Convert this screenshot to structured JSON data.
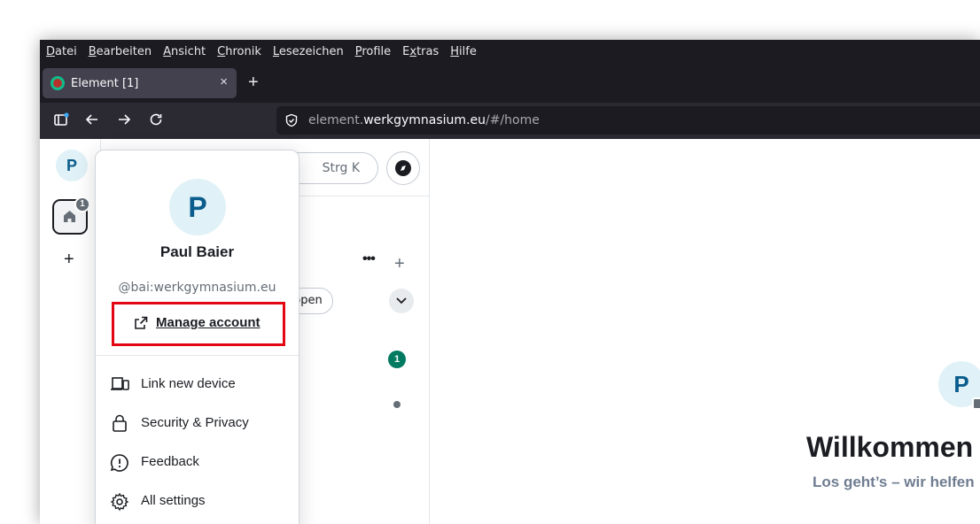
{
  "browser": {
    "menu": [
      "Datei",
      "Bearbeiten",
      "Ansicht",
      "Chronik",
      "Lesezeichen",
      "Profile",
      "Extras",
      "Hilfe"
    ],
    "menu_accel": [
      "D",
      "B",
      "A",
      "C",
      "L",
      "P",
      "x",
      "H"
    ],
    "tab_title": "Element [1]",
    "tab_close": "×",
    "new_tab": "+",
    "url_prefix": "element.",
    "url_host": "werkgymnasium.eu",
    "url_path": "/#/home"
  },
  "spaces": {
    "avatar_initial": "P",
    "home_badge": "1",
    "add_label": "+"
  },
  "room_list": {
    "search_shortcut": "Strg K",
    "more_label": "•••",
    "add_label": "+",
    "filter_chip_visible": "ppen",
    "unread_count": "1"
  },
  "main": {
    "avatar_initial": "P",
    "welcome_title": "Willkommen",
    "welcome_subtitle": "Los geht’s – wir helfen"
  },
  "user_menu": {
    "avatar_initial": "P",
    "display_name": "Paul Baier",
    "mxid": "@bai:werkgymnasium.eu",
    "manage_account": "Manage account",
    "items": [
      {
        "label": "Link new device",
        "icon": "devices-icon"
      },
      {
        "label": "Security & Privacy",
        "icon": "lock-icon"
      },
      {
        "label": "Feedback",
        "icon": "feedback-icon"
      },
      {
        "label": "All settings",
        "icon": "gear-icon"
      }
    ],
    "highlight_color": "#e30613"
  }
}
